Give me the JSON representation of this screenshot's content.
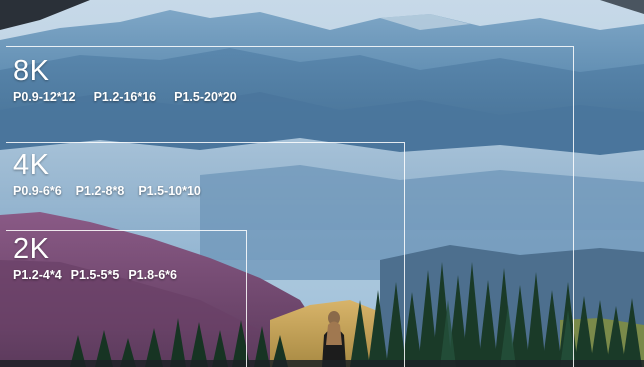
{
  "resolutions": [
    {
      "title": "8K",
      "specs": [
        "P0.9-12*12",
        "P1.2-16*16",
        "P1.5-20*20"
      ]
    },
    {
      "title": "4K",
      "specs": [
        "P0.9-6*6",
        "P1.2-8*8",
        "P1.5-10*10"
      ]
    },
    {
      "title": "2K",
      "specs": [
        "P1.2-4*4",
        "P1.5-5*5",
        "P1.8-6*6"
      ]
    }
  ],
  "colors": {
    "sky": "#9fc3dc",
    "mountain_far": "#5f8fb5",
    "mountain_mid": "#3f6d93",
    "forest_autumn": "#7a4a6e",
    "trees": "#1d3a2a",
    "frame_line": "#ffffff"
  }
}
